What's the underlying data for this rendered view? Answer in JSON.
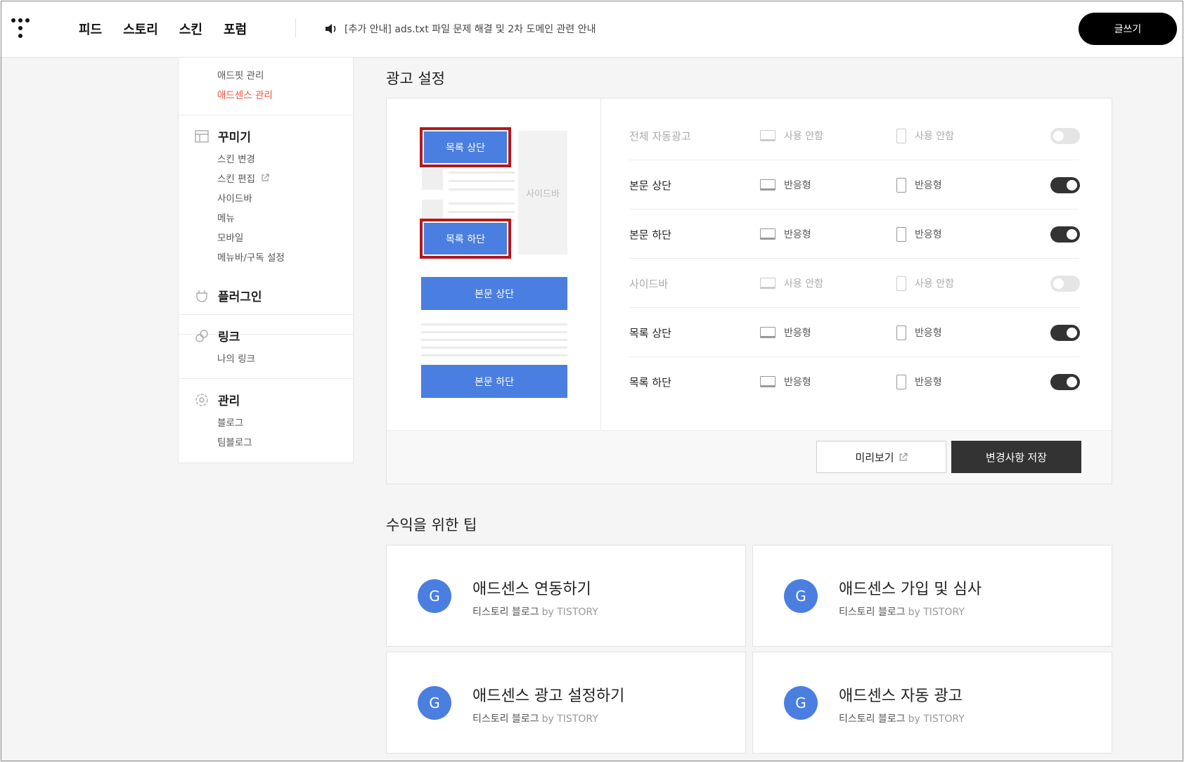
{
  "header": {
    "nav": [
      "피드",
      "스토리",
      "스킨",
      "포럼"
    ],
    "notice": "[추가 안내] ads.txt 파일 문제 해결 및 2차 도메인 관련 안내",
    "write_label": "글쓰기"
  },
  "sidebar": {
    "revenue_items": [
      "애드핏 관리",
      "애드센스 관리"
    ],
    "decorate": {
      "title": "꾸미기",
      "items": [
        "스킨 변경",
        "스킨 편집",
        "사이드바",
        "메뉴",
        "모바일",
        "메뉴바/구독 설정"
      ]
    },
    "plugin": {
      "title": "플러그인"
    },
    "link": {
      "title": "링크",
      "items": [
        "나의 링크"
      ]
    },
    "manage": {
      "title": "관리",
      "items": [
        "블로그",
        "팀블로그"
      ]
    }
  },
  "ad_settings": {
    "title": "광고 설정",
    "preview": {
      "list_top": "목록 상단",
      "sidebar": "사이드바",
      "list_bottom": "목록 하단",
      "body_top": "본문 상단",
      "body_bottom": "본문 하단"
    },
    "rows": [
      {
        "label": "전체 자동광고",
        "pc": "사용 안함",
        "mobile": "사용 안함",
        "enabled": false
      },
      {
        "label": "본문 상단",
        "pc": "반응형",
        "mobile": "반응형",
        "enabled": true
      },
      {
        "label": "본문 하단",
        "pc": "반응형",
        "mobile": "반응형",
        "enabled": true
      },
      {
        "label": "사이드바",
        "pc": "사용 안함",
        "mobile": "사용 안함",
        "enabled": false
      },
      {
        "label": "목록 상단",
        "pc": "반응형",
        "mobile": "반응형",
        "enabled": true
      },
      {
        "label": "목록 하단",
        "pc": "반응형",
        "mobile": "반응형",
        "enabled": true
      }
    ],
    "preview_label": "미리보기",
    "save_label": "변경사항 저장"
  },
  "tips": {
    "title": "수익을 위한 팁",
    "items": [
      {
        "title": "애드센스 연동하기",
        "source": "티스토리 블로그",
        "by": "by TISTORY",
        "icon": "G"
      },
      {
        "title": "애드센스 가입 및 심사",
        "source": "티스토리 블로그",
        "by": "by TISTORY",
        "icon": "G"
      },
      {
        "title": "애드센스 광고 설정하기",
        "source": "티스토리 블로그",
        "by": "by TISTORY",
        "icon": "G"
      },
      {
        "title": "애드센스 자동 광고",
        "source": "티스토리 블로그",
        "by": "by TISTORY",
        "icon": "G"
      }
    ]
  },
  "colors": {
    "accent": "#4a7ee0",
    "active": "#f04d3a",
    "highlight": "#b5181c"
  }
}
